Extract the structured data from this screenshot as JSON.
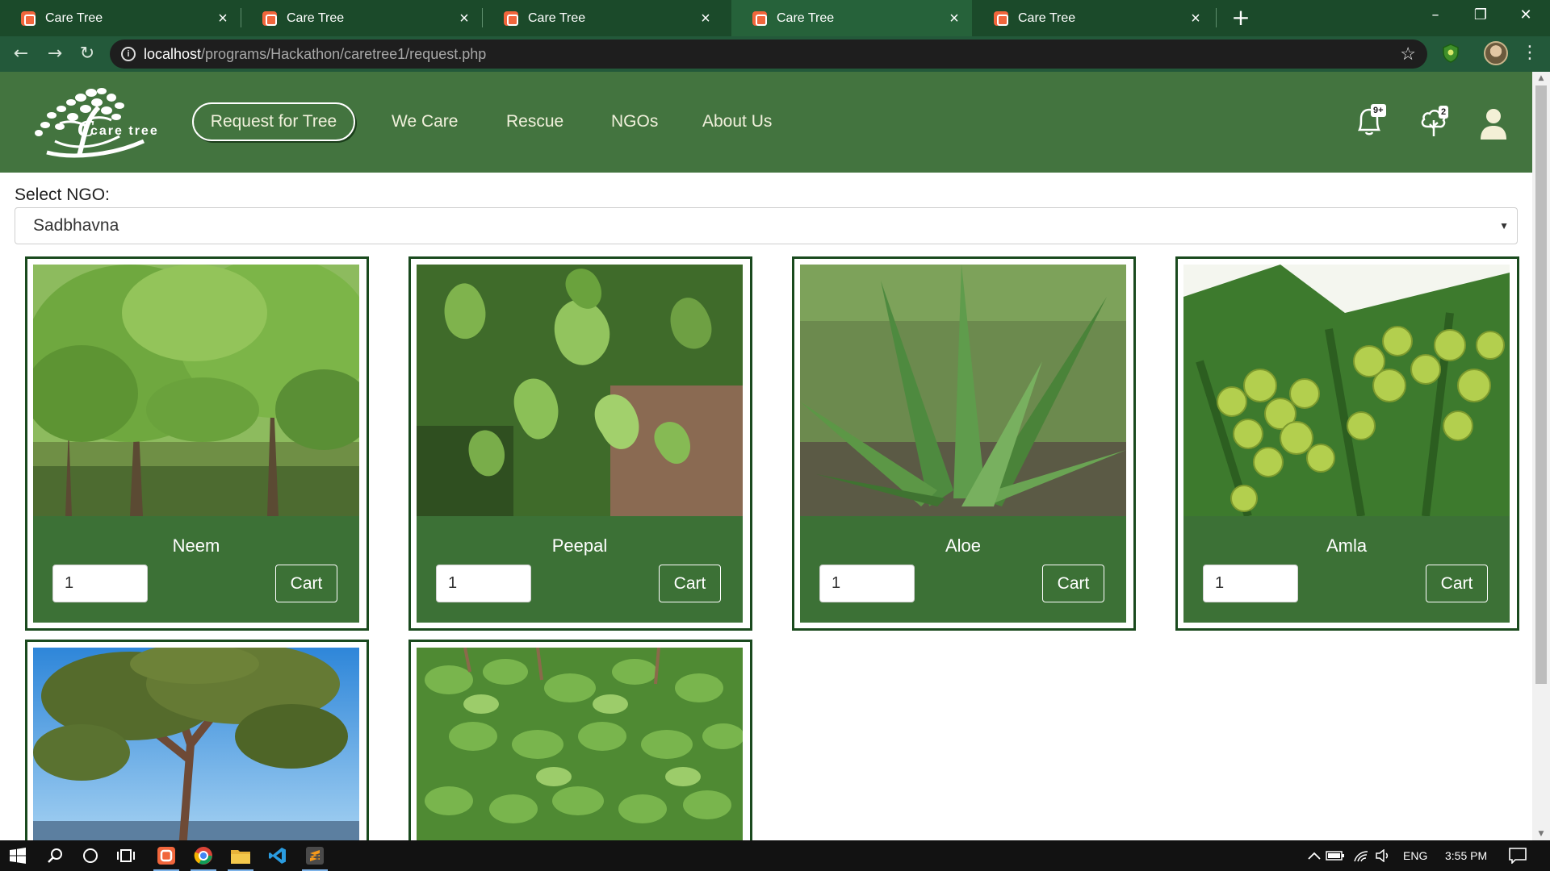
{
  "browser": {
    "tabs": [
      {
        "title": "Care Tree",
        "active": false
      },
      {
        "title": "Care Tree",
        "active": false
      },
      {
        "title": "Care Tree",
        "active": false
      },
      {
        "title": "Care Tree",
        "active": true
      },
      {
        "title": "Care Tree",
        "active": false
      }
    ],
    "url_host": "localhost",
    "url_path": "/programs/Hackathon/caretree1/request.php"
  },
  "header": {
    "logo_text": "care tree",
    "nav": {
      "request": "Request for Tree",
      "we_care": "We Care",
      "rescue": "Rescue",
      "ngos": "NGOs",
      "about": "About Us"
    },
    "notifications_badge": "9+",
    "tree_badge": "2"
  },
  "ngo": {
    "label": "Select NGO:",
    "selected": "Sadbhavna"
  },
  "products": [
    {
      "name": "Neem",
      "qty": "1",
      "cart_label": "Cart"
    },
    {
      "name": "Peepal",
      "qty": "1",
      "cart_label": "Cart"
    },
    {
      "name": "Aloe",
      "qty": "1",
      "cart_label": "Cart"
    },
    {
      "name": "Amla",
      "qty": "1",
      "cart_label": "Cart"
    }
  ],
  "taskbar": {
    "language": "ENG",
    "time": "3:55 PM"
  }
}
